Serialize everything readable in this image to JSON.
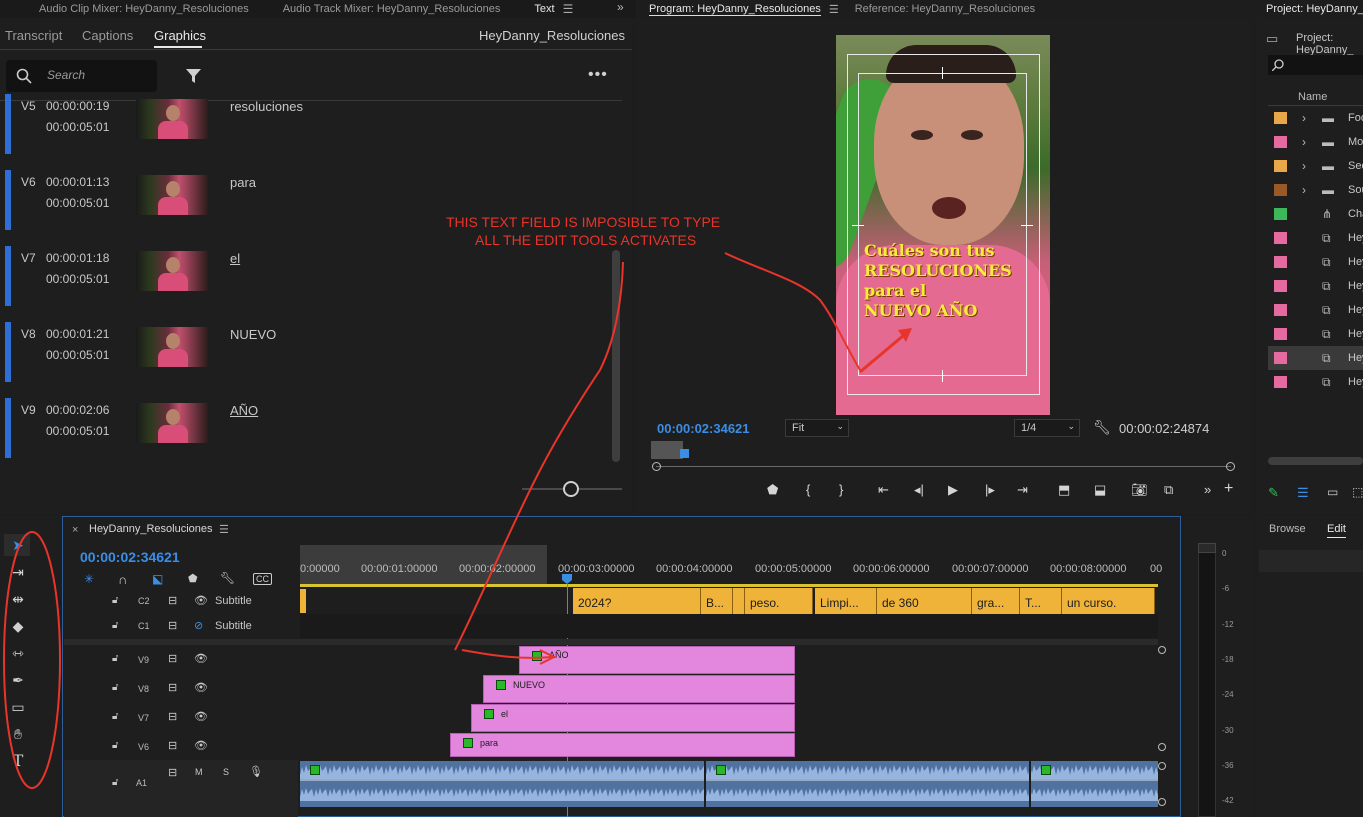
{
  "top_tabs": {
    "audio_clip_mixer": "Audio Clip Mixer: HeyDanny_Resoluciones",
    "audio_track_mixer": "Audio Track Mixer: HeyDanny_Resoluciones",
    "text": "Text",
    "program": "Program: HeyDanny_Resoluciones",
    "reference": "Reference: HeyDanny_Resoluciones",
    "project": "Project: HeyDanny_"
  },
  "text_panel": {
    "tabs": [
      "Transcript",
      "Captions",
      "Graphics"
    ],
    "active_tab": "Graphics",
    "sequence_name": "HeyDanny_Resoluciones",
    "search_placeholder": "Search",
    "items": [
      {
        "track": "V5",
        "start": "00:00:00:19",
        "duration": "00:00:05:01",
        "label": "resoluciones"
      },
      {
        "track": "V6",
        "start": "00:00:01:13",
        "duration": "00:00:05:01",
        "label": "para"
      },
      {
        "track": "V7",
        "start": "00:00:01:18",
        "duration": "00:00:05:01",
        "label": "el"
      },
      {
        "track": "V8",
        "start": "00:00:01:21",
        "duration": "00:00:05:01",
        "label": "NUEVO"
      },
      {
        "track": "V9",
        "start": "00:00:02:06",
        "duration": "00:00:05:01",
        "label": "AÑO"
      }
    ]
  },
  "program_monitor": {
    "overlay_text": [
      "Cuáles son tus",
      "RESOLUCIONES",
      "para el",
      "NUEVO AÑO"
    ],
    "current_time": "00:00:02:34621",
    "fit": "Fit",
    "resolution": "1/4",
    "duration": "00:00:02:24874"
  },
  "annotation": {
    "line1": "THIS TEXT FIELD IS IMPOSIBLE TO TYPE",
    "line2": "ALL THE EDIT TOOLS ACTIVATES"
  },
  "timeline": {
    "sequence_name": "HeyDanny_Resoluciones",
    "timecode": "00:00:02:34621",
    "ruler": [
      "0:00000",
      "00:00:01:00000",
      "00:00:02:00000",
      "00:00:03:00000",
      "00:00:04:00000",
      "00:00:05:00000",
      "00:00:06:00000",
      "00:00:07:00000",
      "00:00:08:00000",
      "00"
    ],
    "tracks": {
      "c2": {
        "name": "C2",
        "label": "Subtitle"
      },
      "c1": {
        "name": "C1",
        "label": "Subtitle"
      },
      "v9": {
        "name": "V9"
      },
      "v8": {
        "name": "V8"
      },
      "v7": {
        "name": "V7"
      },
      "v6": {
        "name": "V6"
      },
      "a1": {
        "name": "A1",
        "m": "M",
        "s": "S"
      }
    },
    "captions": [
      "2024?",
      "B...",
      "peso.",
      "Limpi...",
      "de 360",
      "gra...",
      "T...",
      "un curso."
    ],
    "clips": {
      "v9": "AÑO",
      "v8": "NUEVO",
      "v7": "el",
      "v6": "para"
    }
  },
  "project_panel": {
    "column_name": "Name",
    "rows": [
      {
        "color": "#e8a84a",
        "name": "Foo"
      },
      {
        "color": "#e46aa0",
        "name": "Mo"
      },
      {
        "color": "#e8a84a",
        "name": "Sec"
      },
      {
        "color": "#9a5a28",
        "name": "Sou"
      },
      {
        "color": "#3cb85a",
        "name": "Cha"
      },
      {
        "color": "#e46aa0",
        "name": "Hey"
      },
      {
        "color": "#e46aa0",
        "name": "Hey"
      },
      {
        "color": "#e46aa0",
        "name": "Hey"
      },
      {
        "color": "#e46aa0",
        "name": "Hey"
      },
      {
        "color": "#e46aa0",
        "name": "Hey"
      },
      {
        "color": "#e46aa0",
        "name": "Hey"
      },
      {
        "color": "#e46aa0",
        "name": "Hey"
      }
    ]
  },
  "essential_graphics": {
    "browse": "Browse",
    "edit": "Edit"
  },
  "vu_meter": [
    "0",
    "-6",
    "-12",
    "-18",
    "-24",
    "-30",
    "-36",
    "-42"
  ]
}
